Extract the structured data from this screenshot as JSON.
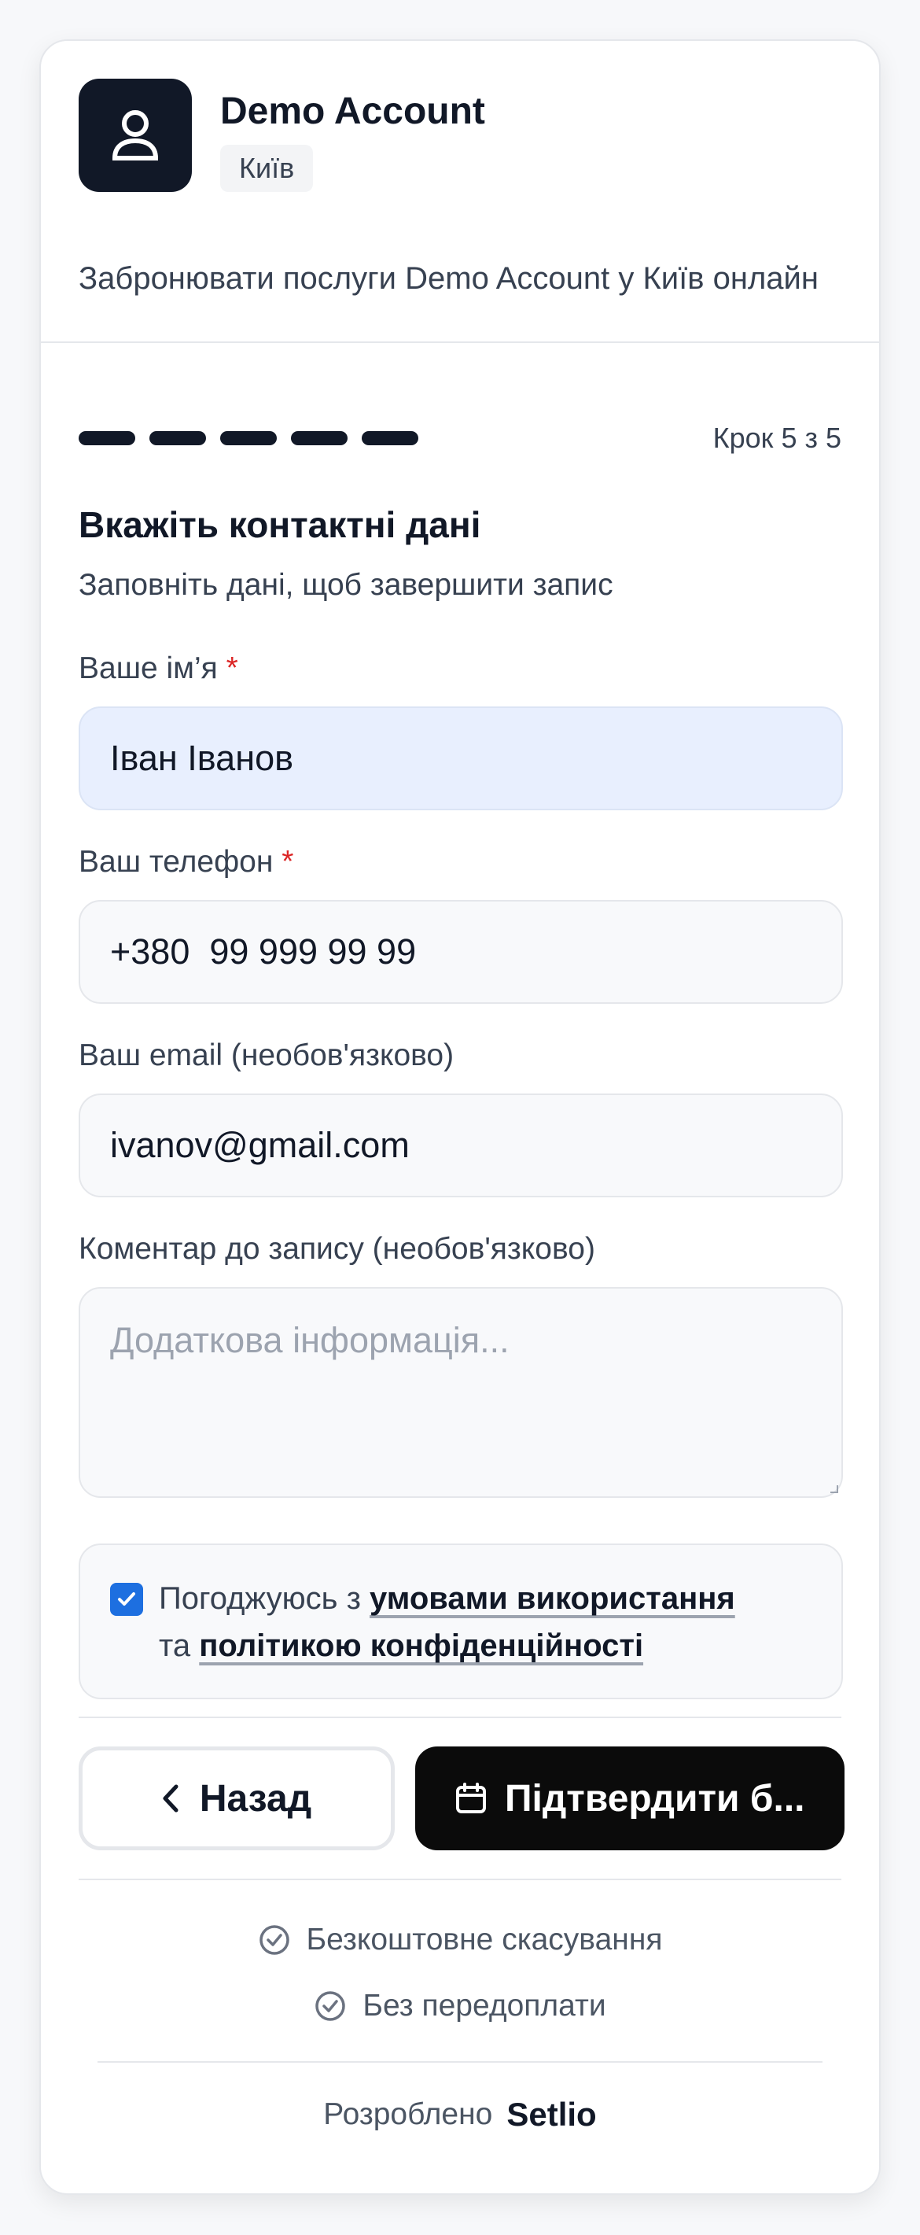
{
  "business": {
    "name": "Demo Account",
    "city": "Київ",
    "subtitle": "Забронювати послуги Demo Account у Київ онлайн"
  },
  "progress": {
    "current_step": 5,
    "total_steps": 5,
    "step_label": "Крок 5 з 5"
  },
  "form": {
    "title": "Вкажіть контактні дані",
    "subtitle": "Заповніть дані, щоб завершити запис",
    "name_label": "Ваше ім’я",
    "name_value": "Іван Іванов",
    "phone_label": "Ваш телефон",
    "phone_value": "+380  99 999 99 99",
    "email_label": "Ваш email (необов'язково)",
    "email_value": "ivanov@gmail.com",
    "comment_label": "Коментар до запису (необов'язково)",
    "comment_placeholder": "Додаткова інформація...",
    "required_mark": "*"
  },
  "consent": {
    "checked": true,
    "prefix": "Погоджуюсь з",
    "terms_link": "умовами використання",
    "middle": "та",
    "privacy_link": "політикою конфіденційності"
  },
  "actions": {
    "back_label": "Назад",
    "confirm_label": "Підтвердити б..."
  },
  "features": [
    {
      "label": "Безкоштовне скасування",
      "icon": "check-circle-icon"
    },
    {
      "label": "Без передоплати",
      "icon": "check-circle-icon"
    }
  ],
  "footer": {
    "prefix": "Розроблено",
    "brand": "Setlio"
  },
  "colors": {
    "primary": "#111827",
    "button_dark": "#0b0b0b",
    "required": "#dc2626",
    "checkbox": "#1d6fe0",
    "autofill_bg": "#e8effe"
  }
}
